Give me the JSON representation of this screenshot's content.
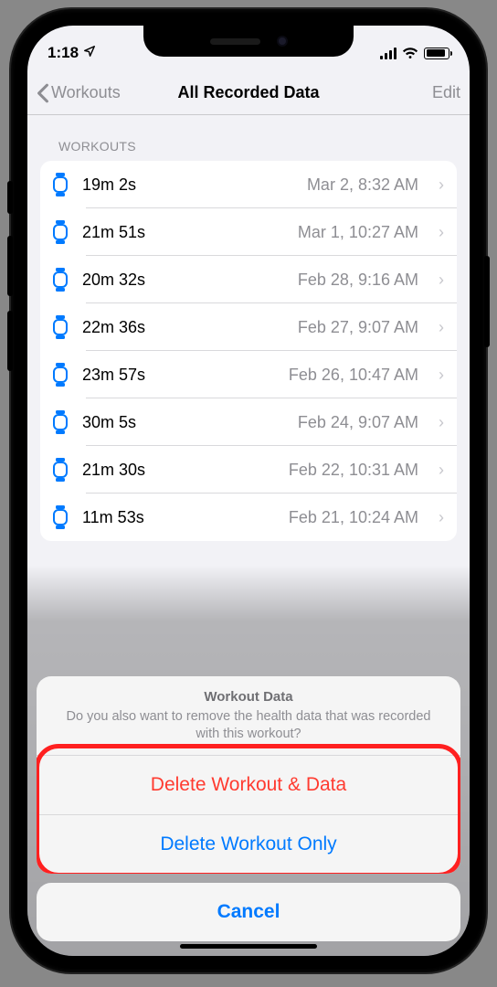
{
  "status": {
    "time": "1:18"
  },
  "nav": {
    "back": "Workouts",
    "title": "All Recorded Data",
    "edit": "Edit"
  },
  "section": {
    "header": "WORKOUTS"
  },
  "rows": [
    {
      "label": "19m 2s",
      "detail": "Mar 2, 8:32 AM"
    },
    {
      "label": "21m 51s",
      "detail": "Mar 1, 10:27 AM"
    },
    {
      "label": "20m 32s",
      "detail": "Feb 28, 9:16 AM"
    },
    {
      "label": "22m 36s",
      "detail": "Feb 27, 9:07 AM"
    },
    {
      "label": "23m 57s",
      "detail": "Feb 26, 10:47 AM"
    },
    {
      "label": "30m 5s",
      "detail": "Feb 24, 9:07 AM"
    },
    {
      "label": "21m 30s",
      "detail": "Feb 22, 10:31 AM"
    },
    {
      "label": "11m 53s",
      "detail": "Feb 21, 10:24 AM"
    }
  ],
  "sheet": {
    "title": "Workout Data",
    "message": "Do you also want to remove the health data that was recorded with this workout?",
    "deleteAll": "Delete Workout & Data",
    "deleteOnly": "Delete Workout Only",
    "cancel": "Cancel"
  }
}
